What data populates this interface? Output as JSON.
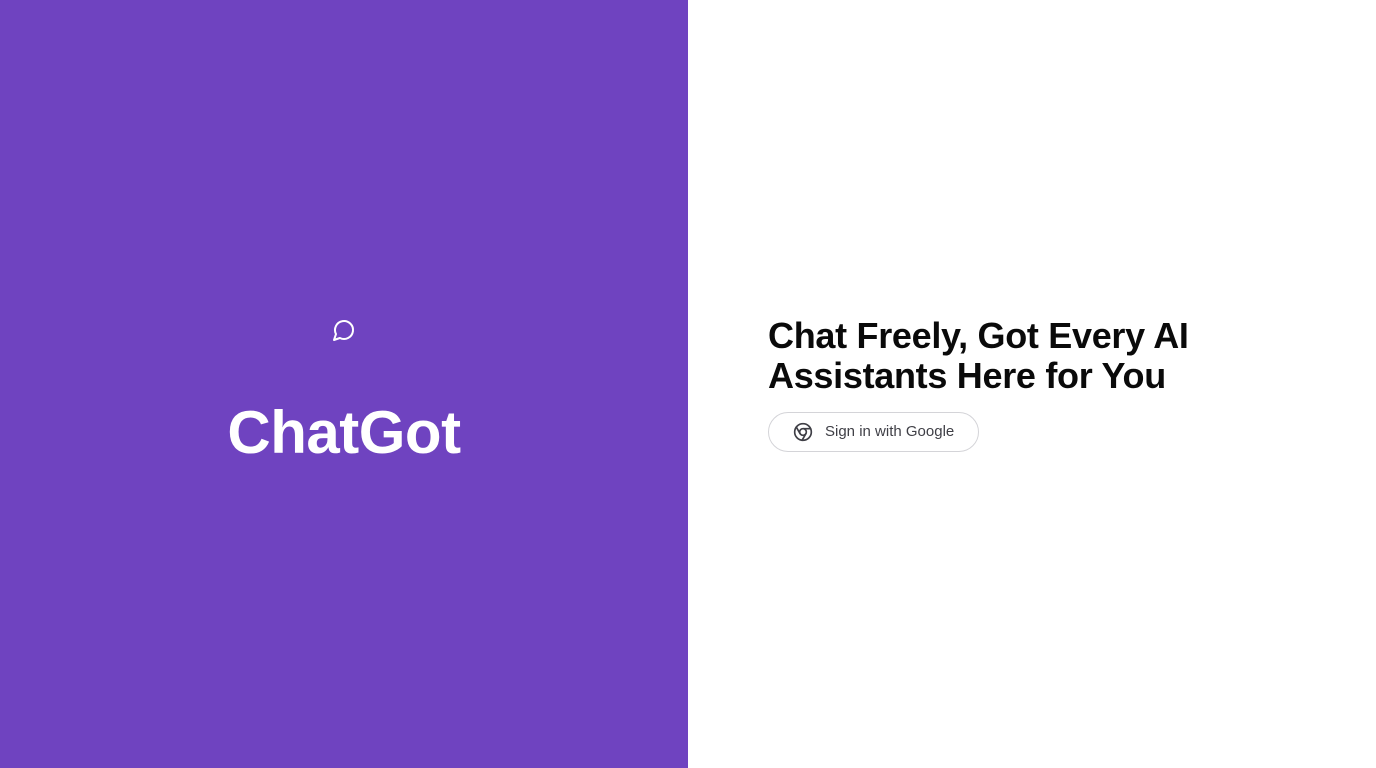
{
  "brand": {
    "name": "ChatGot",
    "icon": "chat-bubble-icon",
    "background_color": "#6f43c0"
  },
  "main": {
    "headline": "Chat Freely, Got Every AI Assistants Here for You",
    "signin_button": {
      "label": "Sign in with Google",
      "icon": "chrome-icon"
    }
  }
}
